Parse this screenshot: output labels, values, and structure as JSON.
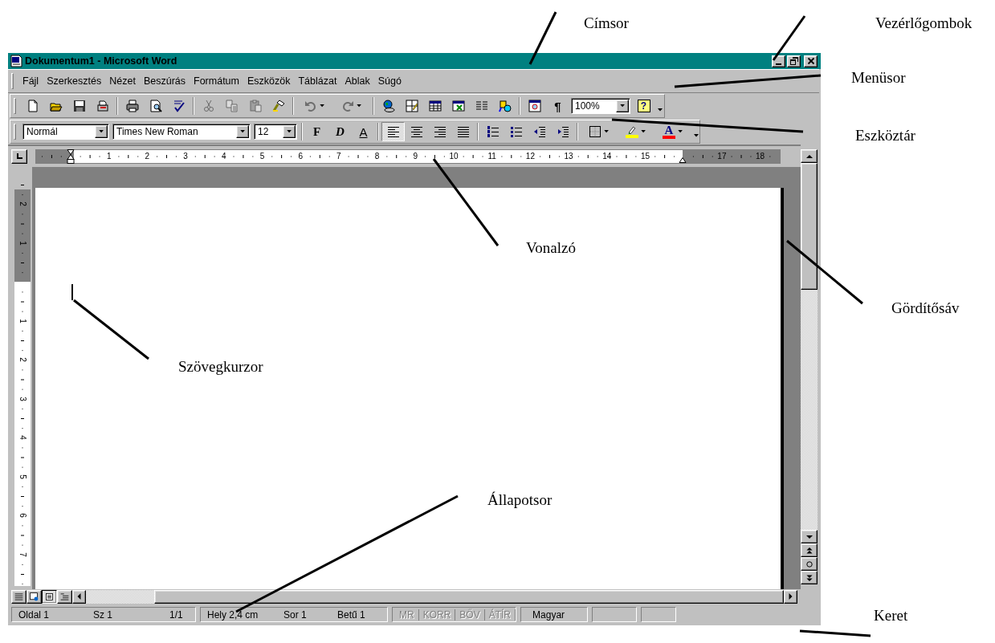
{
  "window": {
    "title": "Dokumentum1 - Microsoft Word"
  },
  "menu": [
    "Fájl",
    "Szerkesztés",
    "Nézet",
    "Beszúrás",
    "Formátum",
    "Eszközök",
    "Táblázat",
    "Ablak",
    "Súgó"
  ],
  "toolbars": [
    {
      "items": [
        {
          "kind": "button",
          "disabled": false
        },
        {
          "kind": "button",
          "disabled": false
        },
        {
          "kind": "button",
          "disabled": false
        },
        {
          "kind": "button",
          "disabled": false
        },
        {
          "kind": "separator"
        },
        {
          "kind": "button",
          "disabled": false
        },
        {
          "kind": "button",
          "disabled": false
        },
        {
          "kind": "button",
          "disabled": false
        },
        {
          "kind": "separator"
        },
        {
          "kind": "button",
          "disabled": true
        },
        {
          "kind": "button",
          "disabled": true
        },
        {
          "kind": "button",
          "disabled": true
        },
        {
          "kind": "button",
          "disabled": false
        },
        {
          "kind": "separator"
        },
        {
          "kind": "split",
          "disabled": true
        },
        {
          "kind": "split",
          "disabled": true
        },
        {
          "kind": "separator"
        },
        {
          "kind": "button",
          "disabled": false
        },
        {
          "kind": "button",
          "disabled": false
        },
        {
          "kind": "button",
          "disabled": false
        },
        {
          "kind": "button",
          "disabled": false
        },
        {
          "kind": "button",
          "disabled": false
        },
        {
          "kind": "button",
          "disabled": false
        },
        {
          "kind": "separator"
        },
        {
          "kind": "button",
          "disabled": false
        },
        {
          "kind": "glyph",
          "glyph": "¶"
        },
        {
          "kind": "combo",
          "value": "100%"
        },
        {
          "kind": "help",
          "glyph": "?"
        },
        {
          "kind": "overflow"
        }
      ]
    },
    {
      "items": [
        {
          "kind": "combo",
          "value": "Normál"
        },
        {
          "kind": "combo",
          "value": "Times New Roman"
        },
        {
          "kind": "combo",
          "value": "12"
        },
        {
          "kind": "separator"
        },
        {
          "kind": "bold",
          "glyph": "F"
        },
        {
          "kind": "italic",
          "glyph": "D"
        },
        {
          "kind": "underline",
          "glyph": "A"
        },
        {
          "kind": "separator"
        },
        {
          "kind": "button",
          "selected": true
        },
        {
          "kind": "button",
          "selected": false
        },
        {
          "kind": "button",
          "selected": false
        },
        {
          "kind": "button",
          "selected": false
        },
        {
          "kind": "separator"
        },
        {
          "kind": "button"
        },
        {
          "kind": "button"
        },
        {
          "kind": "button"
        },
        {
          "kind": "button"
        },
        {
          "kind": "separator"
        },
        {
          "kind": "split"
        },
        {
          "kind": "split",
          "color": "#ffff00"
        },
        {
          "kind": "split",
          "glyph": "A",
          "color": "#ff0000"
        },
        {
          "kind": "overflow"
        }
      ]
    }
  ],
  "horizontal_ruler": {
    "labels": [
      "1",
      "2",
      "3",
      "4",
      "5",
      "6",
      "7",
      "8",
      "9",
      "10",
      "11",
      "12",
      "13",
      "14",
      "15",
      "17",
      "18"
    ]
  },
  "vertical_ruler": {
    "top_margin_labels": [
      "2",
      "1"
    ],
    "labels": [
      "1",
      "2",
      "3",
      "4",
      "5",
      "6",
      "7"
    ]
  },
  "view_buttons": [
    {
      "selected": false
    },
    {
      "selected": false
    },
    {
      "selected": true
    },
    {
      "selected": false
    }
  ],
  "status_bar": [
    {
      "kind": "fields",
      "items": [
        "Oldal 1",
        "Sz 1",
        "1/1"
      ]
    },
    {
      "kind": "fields",
      "items": [
        "Hely 2,4 cm",
        "Sor 1",
        "Betű 1"
      ]
    },
    {
      "kind": "indicators",
      "items": [
        {
          "text": "MR",
          "disabled": true
        },
        {
          "text": "KORR",
          "disabled": true
        },
        {
          "text": "BŐV",
          "disabled": true
        },
        {
          "text": "ÁTÍR",
          "disabled": true
        }
      ]
    },
    {
      "kind": "text",
      "text": "Magyar"
    }
  ],
  "annotations": [
    "Címsor",
    "Vezérlőgombok",
    "Menüsor",
    "Eszköztár",
    "Vonalzó",
    "Gördítősáv",
    "Szövegkurzor",
    "Állapotsor",
    "Keret"
  ]
}
